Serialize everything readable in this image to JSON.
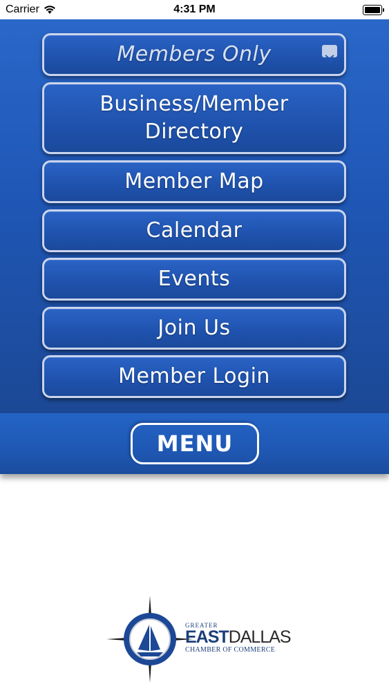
{
  "status_bar": {
    "carrier": "Carrier",
    "time": "4:31 PM"
  },
  "menu": {
    "header": "Members Only",
    "items": [
      "Business/Member Directory",
      "Member Map",
      "Calendar",
      "Events",
      "Join Us",
      "Member Login"
    ],
    "toggle_label": "MENU"
  },
  "logo": {
    "greater": "GREATER",
    "east": "EAST",
    "dallas": "DALLAS",
    "chamber": "CHAMBER OF COMMERCE"
  },
  "colors": {
    "panel_blue": "#1f57b6",
    "button_border": "#c9d4ee",
    "logo_navy": "#1c3f7a"
  }
}
